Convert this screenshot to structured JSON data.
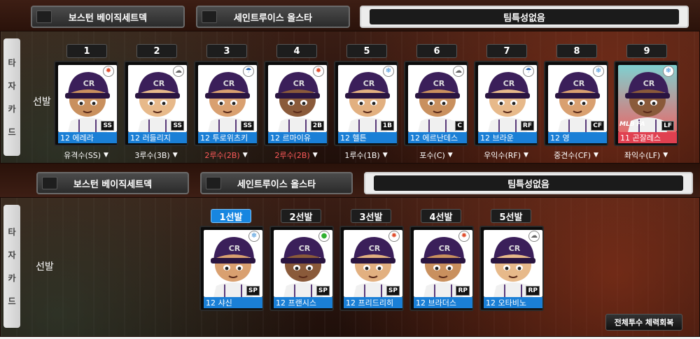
{
  "top": {
    "tabs": [
      "보스턴 베이직세트덱",
      "세인트루이스 올스타",
      "팀특성없음"
    ],
    "side_label": [
      "타",
      "자",
      "카",
      "드"
    ],
    "row_label": "선발",
    "numbers": [
      "1",
      "2",
      "3",
      "4",
      "5",
      "6",
      "7",
      "8",
      "9"
    ],
    "cards": [
      {
        "name": "12 에레라",
        "pos": "SS",
        "badge": "fire",
        "dropdown": "유격수(SS)",
        "warn": false
      },
      {
        "name": "12 러들리지",
        "pos": "SS",
        "badge": "cloud",
        "dropdown": "3루수(3B)",
        "warn": false
      },
      {
        "name": "12 투로위츠키",
        "pos": "SS",
        "badge": "umbrella",
        "dropdown": "2루수(2B)",
        "warn": true
      },
      {
        "name": "12 르마이유",
        "pos": "2B",
        "badge": "fire",
        "dropdown": "2루수(2B)",
        "warn": true
      },
      {
        "name": "12 헬튼",
        "pos": "1B",
        "badge": "snow",
        "dropdown": "1루수(1B)",
        "warn": false
      },
      {
        "name": "12 에르난데스",
        "pos": "C",
        "badge": "cloud",
        "dropdown": "포수(C)",
        "warn": false
      },
      {
        "name": "12 브라운",
        "pos": "RF",
        "badge": "umbrella",
        "dropdown": "우익수(RF)",
        "warn": false
      },
      {
        "name": "12 영",
        "pos": "CF",
        "badge": "snow",
        "dropdown": "중견수(CF)",
        "warn": false
      },
      {
        "name": "11 곤잘레스",
        "pos": "LF",
        "badge": "snow",
        "dropdown": "좌익수(LF)",
        "warn": false,
        "fa": true
      }
    ],
    "fa_text": "MLB FA"
  },
  "bottom": {
    "tabs": [
      "보스턴 베이직세트덱",
      "세인트루이스 올스타",
      "팀특성없음"
    ],
    "side_label": [
      "타",
      "자",
      "카",
      "드"
    ],
    "row_label": "선발",
    "numbers": [
      "1선발",
      "2선발",
      "3선발",
      "4선발",
      "5선발"
    ],
    "active_index": 0,
    "cards": [
      {
        "name": "12 샤신",
        "pos": "SP",
        "badge": "snow"
      },
      {
        "name": "12 프랜시스",
        "pos": "SP",
        "badge": "green"
      },
      {
        "name": "12 프리드리히",
        "pos": "SP",
        "badge": "fire"
      },
      {
        "name": "12 브라더스",
        "pos": "RP",
        "badge": "fire"
      },
      {
        "name": "12 오타비노",
        "pos": "RP",
        "badge": "cloud"
      }
    ],
    "restore_button": "전체투수 체력회복"
  }
}
